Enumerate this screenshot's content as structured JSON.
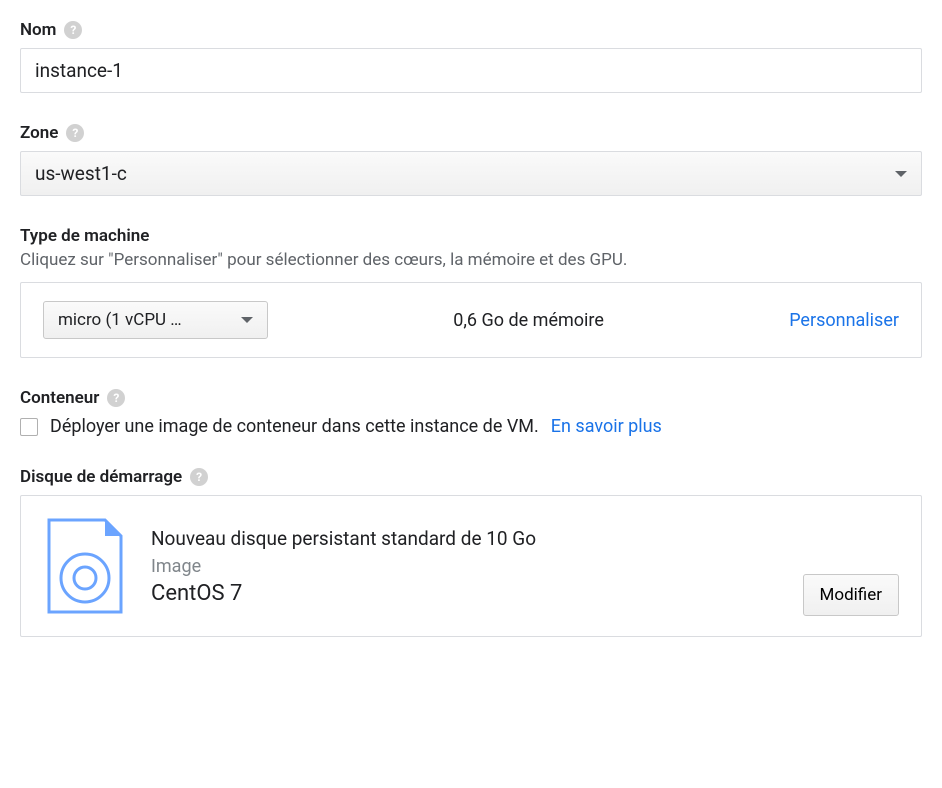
{
  "name": {
    "label": "Nom",
    "value": "instance-1"
  },
  "zone": {
    "label": "Zone",
    "value": "us-west1-c"
  },
  "machine_type": {
    "label": "Type de machine",
    "description": "Cliquez sur \"Personnaliser\" pour sélectionner des cœurs, la mémoire et des GPU.",
    "selected": "micro (1 vCPU …",
    "memory": "0,6 Go de mémoire",
    "customize": "Personnaliser"
  },
  "container": {
    "label": "Conteneur",
    "checkbox_label": "Déployer une image de conteneur dans cette instance de VM.",
    "learn_more": "En savoir plus"
  },
  "boot_disk": {
    "label": "Disque de démarrage",
    "title": "Nouveau disque persistant standard de 10 Go",
    "image_label": "Image",
    "os": "CentOS 7",
    "modify": "Modifier"
  }
}
